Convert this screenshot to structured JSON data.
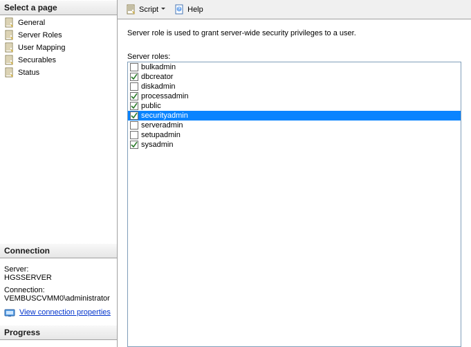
{
  "sidebar": {
    "select_page_header": "Select a page",
    "pages": [
      {
        "label": "General"
      },
      {
        "label": "Server Roles"
      },
      {
        "label": "User Mapping"
      },
      {
        "label": "Securables"
      },
      {
        "label": "Status"
      }
    ],
    "connection_header": "Connection",
    "server_label": "Server:",
    "server_value": "HGSSERVER",
    "connection_label": "Connection:",
    "connection_value": "VEMBUSCVMM0\\administrator",
    "view_connection": "View connection properties",
    "progress_header": "Progress"
  },
  "toolbar": {
    "script_label": "Script",
    "help_label": "Help"
  },
  "main": {
    "description": "Server role is used to grant server-wide security privileges to a user.",
    "roles_label": "Server roles:",
    "roles": [
      {
        "label": "bulkadmin",
        "checked": false,
        "selected": false
      },
      {
        "label": "dbcreator",
        "checked": true,
        "selected": false
      },
      {
        "label": "diskadmin",
        "checked": false,
        "selected": false
      },
      {
        "label": "processadmin",
        "checked": true,
        "selected": false
      },
      {
        "label": "public",
        "checked": true,
        "selected": false
      },
      {
        "label": "securityadmin",
        "checked": true,
        "selected": true
      },
      {
        "label": "serveradmin",
        "checked": false,
        "selected": false
      },
      {
        "label": "setupadmin",
        "checked": false,
        "selected": false
      },
      {
        "label": "sysadmin",
        "checked": true,
        "selected": false
      }
    ]
  }
}
